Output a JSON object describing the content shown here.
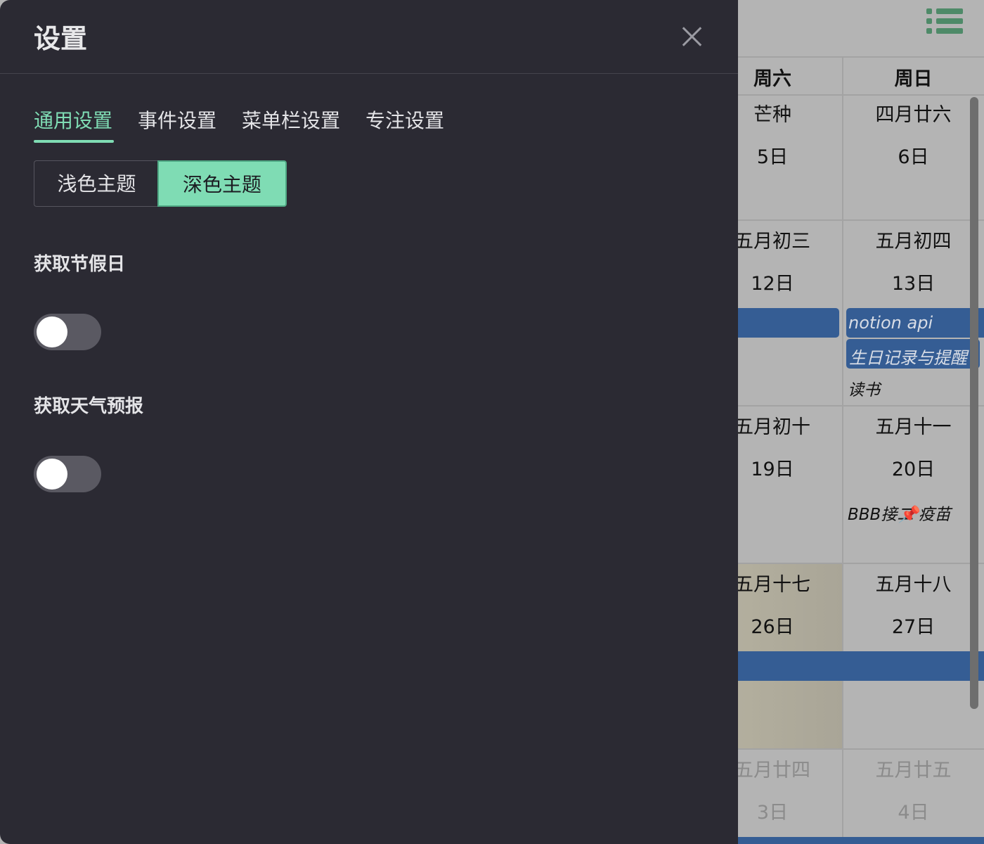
{
  "settings": {
    "title": "设置",
    "tabs": [
      "通用设置",
      "事件设置",
      "菜单栏设置",
      "专注设置"
    ],
    "active_tab": "通用设置",
    "theme": {
      "light_label": "浅色主题",
      "dark_label": "深色主题",
      "selected": "深色主题"
    },
    "holidays": {
      "label": "获取节假日",
      "enabled": false
    },
    "weather": {
      "label": "获取天气预报",
      "enabled": false
    }
  },
  "calendar": {
    "weekdays": [
      "周六",
      "周日"
    ],
    "rows": [
      {
        "sat": {
          "lunar": "芒种",
          "day": "5日"
        },
        "sun": {
          "lunar": "四月廿六",
          "day": "6日"
        }
      },
      {
        "sat": {
          "lunar": "五月初三",
          "day": "12日"
        },
        "sun": {
          "lunar": "五月初四",
          "day": "13日"
        }
      },
      {
        "sat": {
          "lunar": "五月初十",
          "day": "19日"
        },
        "sun": {
          "lunar": "五月十一",
          "day": "20日"
        }
      },
      {
        "sat": {
          "lunar": "五月十七",
          "day": "26日"
        },
        "sun": {
          "lunar": "五月十八",
          "day": "27日"
        }
      },
      {
        "sat": {
          "lunar": "五月廿四",
          "day": "3日"
        },
        "sun": {
          "lunar": "五月廿五",
          "day": "4日"
        }
      }
    ],
    "events": {
      "notion": "notion api",
      "birthday": "生日记录与提醒",
      "reading": "读书",
      "vaccine": "📌疫苗",
      "overlap": "BBB接二"
    },
    "colors": {
      "event": "#355d94",
      "accent": "#7fdcb4"
    }
  }
}
